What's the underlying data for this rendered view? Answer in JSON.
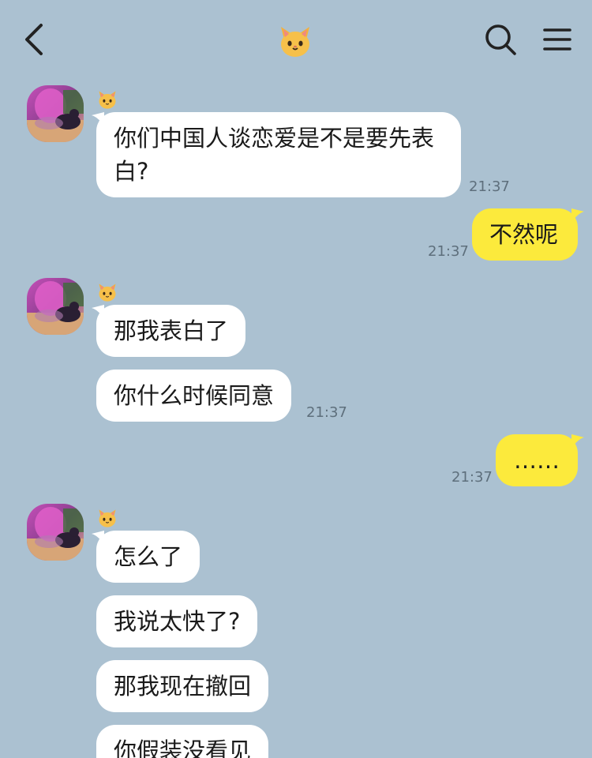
{
  "header": {
    "title_icon": "cat-face-emoji",
    "back_icon": "chevron-left-icon",
    "search_icon": "search-icon",
    "menu_icon": "hamburger-menu-icon"
  },
  "contact": {
    "name_icon": "cat-face-emoji",
    "avatar": "profile-photo"
  },
  "messages": [
    {
      "side": "in",
      "text": "你们中国人谈恋爱是不是要先表白?",
      "time": "21:37"
    },
    {
      "side": "out",
      "text": "不然呢",
      "time": "21:37"
    },
    {
      "side": "in",
      "text": "那我表白了",
      "time": ""
    },
    {
      "side": "in",
      "text": "你什么时候同意",
      "time": "21:37"
    },
    {
      "side": "out",
      "text": "……",
      "time": "21:37"
    },
    {
      "side": "in",
      "text": "怎么了",
      "time": ""
    },
    {
      "side": "in",
      "text": "我说太快了?",
      "time": ""
    },
    {
      "side": "in",
      "text": "那我现在撤回",
      "time": ""
    },
    {
      "side": "in",
      "text": "你假装没看见",
      "time": ""
    }
  ],
  "colors": {
    "background": "#abc1d1",
    "incoming_bubble": "#ffffff",
    "outgoing_bubble": "#fcea3c",
    "timestamp": "#5e6f7c"
  }
}
